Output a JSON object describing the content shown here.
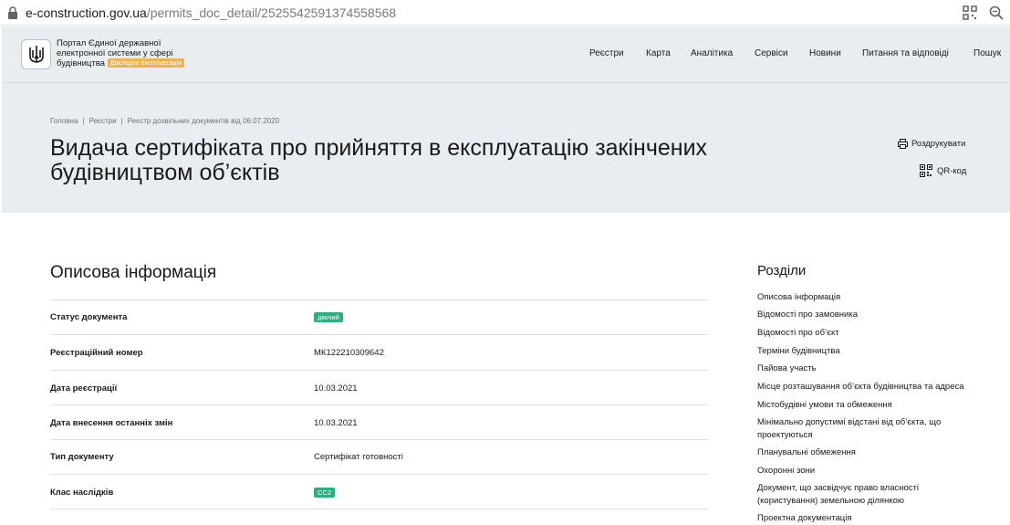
{
  "browser": {
    "url_host": "e-construction.gov.ua",
    "url_path": "/permits_doc_detail/2525542591374558568"
  },
  "header": {
    "portal_line1": "Портал Єдиної державної",
    "portal_line2": "електронної системи у сфері",
    "portal_line3": "будівництва",
    "portal_badge": "Дослідна експлуатація",
    "menu": [
      "Реєстри",
      "Карта",
      "Аналітика",
      "Сервіси",
      "Новини",
      "Питання та відповіді",
      "Пошук"
    ]
  },
  "breadcrumb": [
    "Головна",
    "Реєстри",
    "Реєстр дозвільних документів від 06.07.2020"
  ],
  "page_title_line1": "Видача сертифіката про прийняття в експлуатацію закінчених",
  "page_title_line2": "будівництвом об’єктів",
  "actions": {
    "print": "Роздрукувати",
    "qr": "QR-код"
  },
  "section": {
    "title": "Описова інформація",
    "rows": [
      {
        "label": "Статус документа",
        "value": "діючий"
      },
      {
        "label": "Реєстраційний номер",
        "value": "МК122210309642"
      },
      {
        "label": "Дата реєстрації",
        "value": "10.03.2021"
      },
      {
        "label": "Дата внесення останніх змін",
        "value": "10.03.2021"
      },
      {
        "label": "Тип документу",
        "value": "Сертифікат готовності"
      },
      {
        "label": "Клас наслідків",
        "value": "СС2"
      }
    ]
  },
  "sidebar": {
    "title": "Розділи",
    "items": [
      "Описова інформація",
      "Відомості про замовника",
      "Відомості про об’єкт",
      "Терміни будівництва",
      "Пайова участь",
      "Місце розташування об’єкта будівництва та адреса",
      "Містобудівні умови та обмеження",
      "Мінімально допустимі відстані від об’єкта, що проектуються",
      "Планувальні обмеження",
      "Охоронні зони",
      "Документ, що засвідчує право власності (користування) земельною ділянкою",
      "Проектна документація"
    ]
  },
  "colors": {
    "header_bg": "#e8edf2",
    "badge": "#2eaf80",
    "portal_badge": "#f0b24a"
  }
}
